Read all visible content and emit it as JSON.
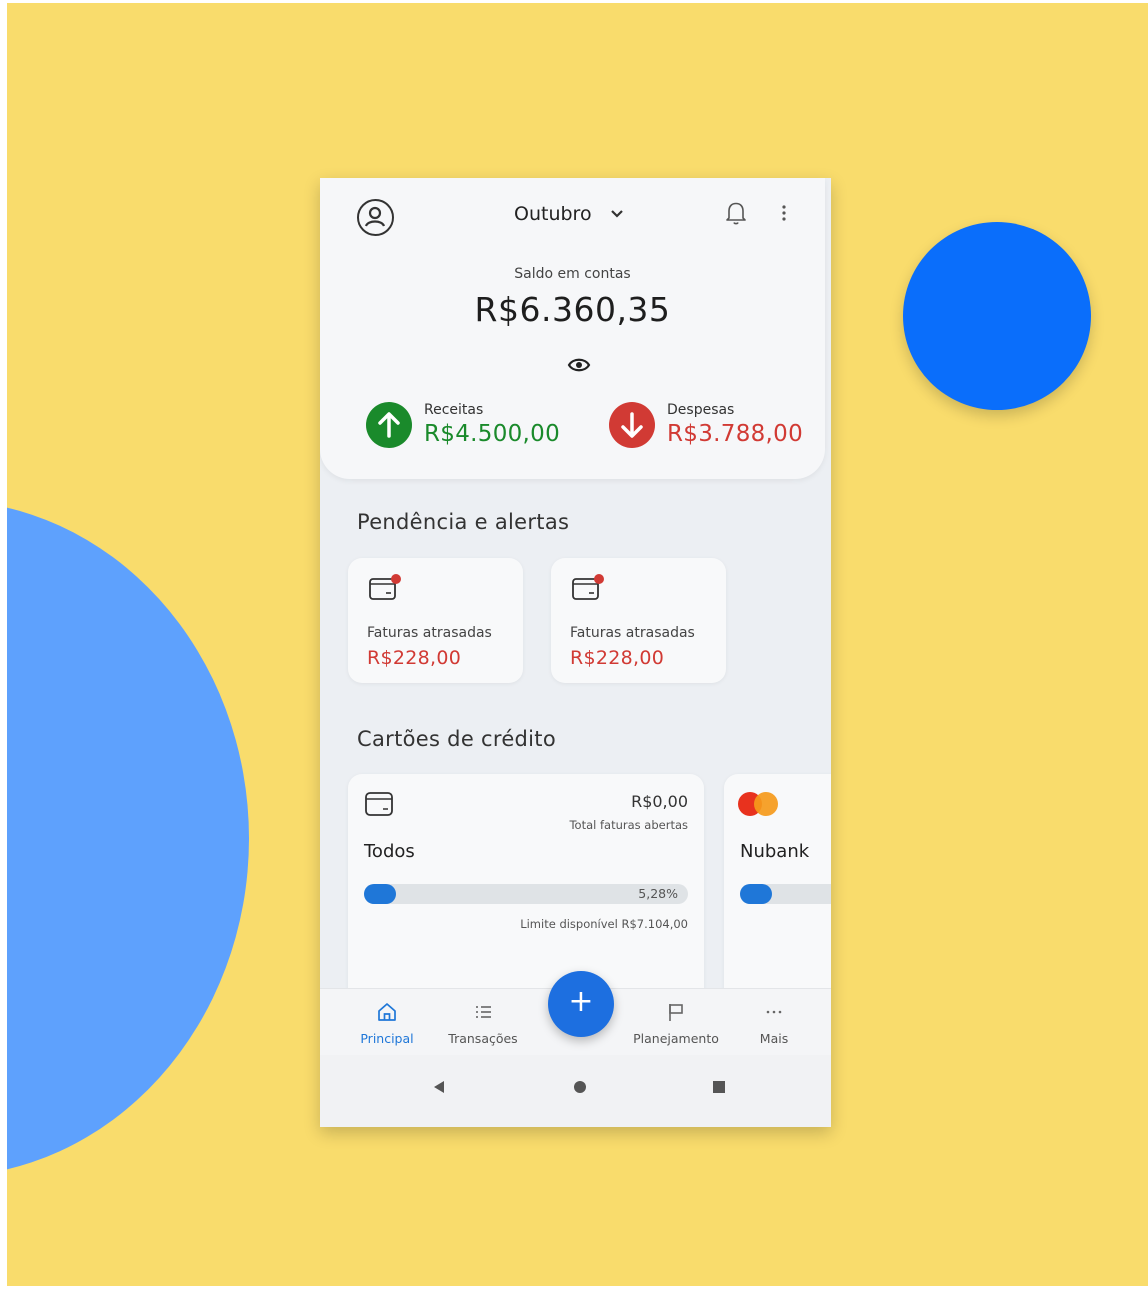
{
  "colors": {
    "background": "#f9dc6c",
    "accent": "#1d6fe0",
    "income": "#1a8a2b",
    "expense": "#d13a34"
  },
  "header": {
    "month": "Outubro",
    "icons": [
      "account-icon",
      "chevron-down-icon",
      "bell-icon",
      "more-vertical-icon"
    ]
  },
  "balance": {
    "label": "Saldo em contas",
    "value": "R$6.360,35"
  },
  "income": {
    "label": "Receitas",
    "value": "R$4.500,00"
  },
  "expenses": {
    "label": "Despesas",
    "value": "R$3.788,00"
  },
  "alerts": {
    "title": "Pendência e alertas",
    "items": [
      {
        "label": "Faturas atrasadas",
        "value": "R$228,00"
      },
      {
        "label": "Faturas atrasadas",
        "value": "R$228,00"
      }
    ]
  },
  "cards": {
    "title": "Cartões de crédito",
    "items": [
      {
        "name": "Todos",
        "total": "R$0,00",
        "total_label": "Total faturas abertas",
        "usage_percent_label": "5,28%",
        "usage_fraction": 0.0528,
        "limit_label": "Limite disponível R$7.104,00"
      },
      {
        "name": "Nubank"
      }
    ]
  },
  "bottom_nav": {
    "items": [
      {
        "label": "Principal",
        "active": true
      },
      {
        "label": "Transações"
      },
      {
        "label": "Planejamento"
      },
      {
        "label": "Mais"
      }
    ],
    "fab_label": "+"
  }
}
